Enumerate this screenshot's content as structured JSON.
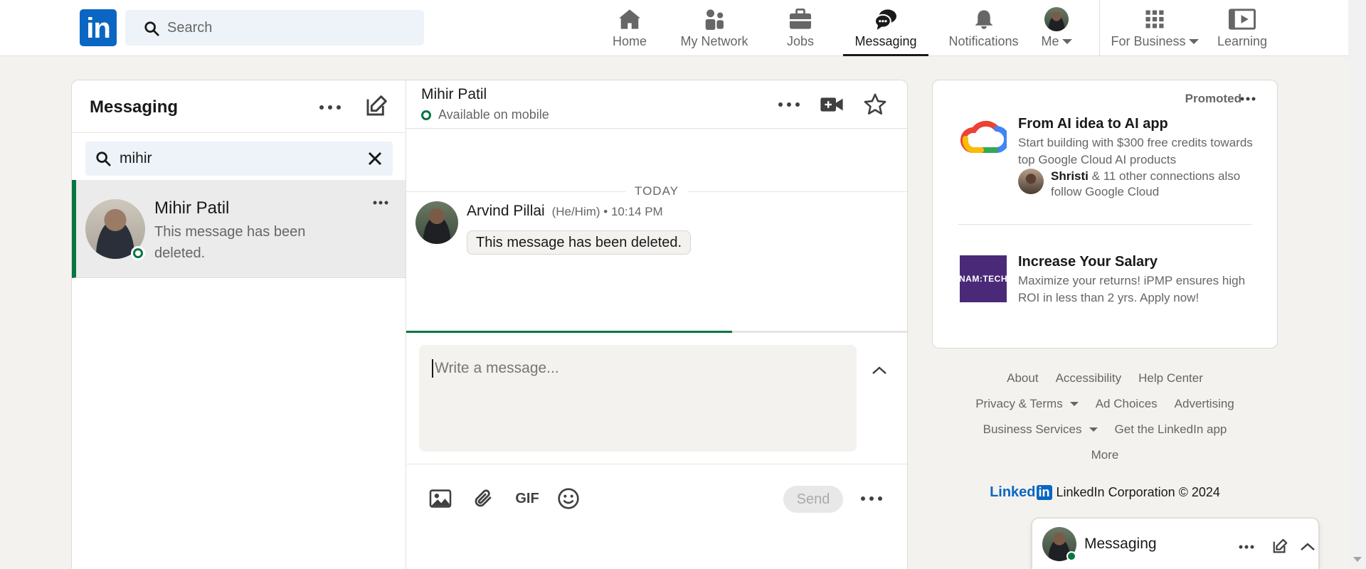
{
  "nav": {
    "search_placeholder": "Search",
    "items": [
      {
        "label": "Home",
        "icon": "home-icon"
      },
      {
        "label": "My Network",
        "icon": "people-icon"
      },
      {
        "label": "Jobs",
        "icon": "briefcase-icon"
      },
      {
        "label": "Messaging",
        "icon": "chat-icon",
        "active": true
      },
      {
        "label": "Notifications",
        "icon": "bell-icon"
      },
      {
        "label": "Me",
        "icon": "avatar"
      },
      {
        "label": "For Business",
        "icon": "grid-icon"
      },
      {
        "label": "Learning",
        "icon": "video-icon"
      }
    ]
  },
  "messaging": {
    "title": "Messaging",
    "search_value": "mihir",
    "conversations": [
      {
        "name": "Mihir Patil",
        "preview": "This message has been deleted."
      }
    ],
    "thread": {
      "name": "Mihir Patil",
      "status": "Available on mobile",
      "date_divider": "TODAY",
      "messages": [
        {
          "sender": "Arvind Pillai",
          "meta": "(He/Him) • 10:14 PM",
          "text": "This message has been deleted."
        }
      ],
      "composer_placeholder": "Write a message...",
      "send_label": "Send",
      "gif_label": "GIF",
      "upload_progress": 0.65
    }
  },
  "ads": {
    "promoted": "Promoted",
    "items": [
      {
        "title": "From AI idea to AI app",
        "description": "Start building with $300 free credits towards top Google Cloud AI products",
        "connection_name": "Shristi",
        "connection_text": " & 11 other connections also follow Google Cloud"
      },
      {
        "title": "Increase Your Salary",
        "description": "Maximize your returns! iPMP ensures high ROI in less than 2 yrs. Apply now!",
        "logo_text": "NAM:TECH"
      }
    ]
  },
  "footer": {
    "about": "About",
    "accessibility": "Accessibility",
    "help_center": "Help Center",
    "privacy_terms": "Privacy & Terms",
    "ad_choices": "Ad Choices",
    "advertising": "Advertising",
    "business_services": "Business Services",
    "get_app": "Get the LinkedIn app",
    "more": "More",
    "brand_word": "Linked",
    "brand_in": "in",
    "copyright": "LinkedIn Corporation © 2024"
  },
  "mini_messaging": {
    "label": "Messaging"
  },
  "colors": {
    "brand": "#0a66c2",
    "online": "#057642"
  }
}
